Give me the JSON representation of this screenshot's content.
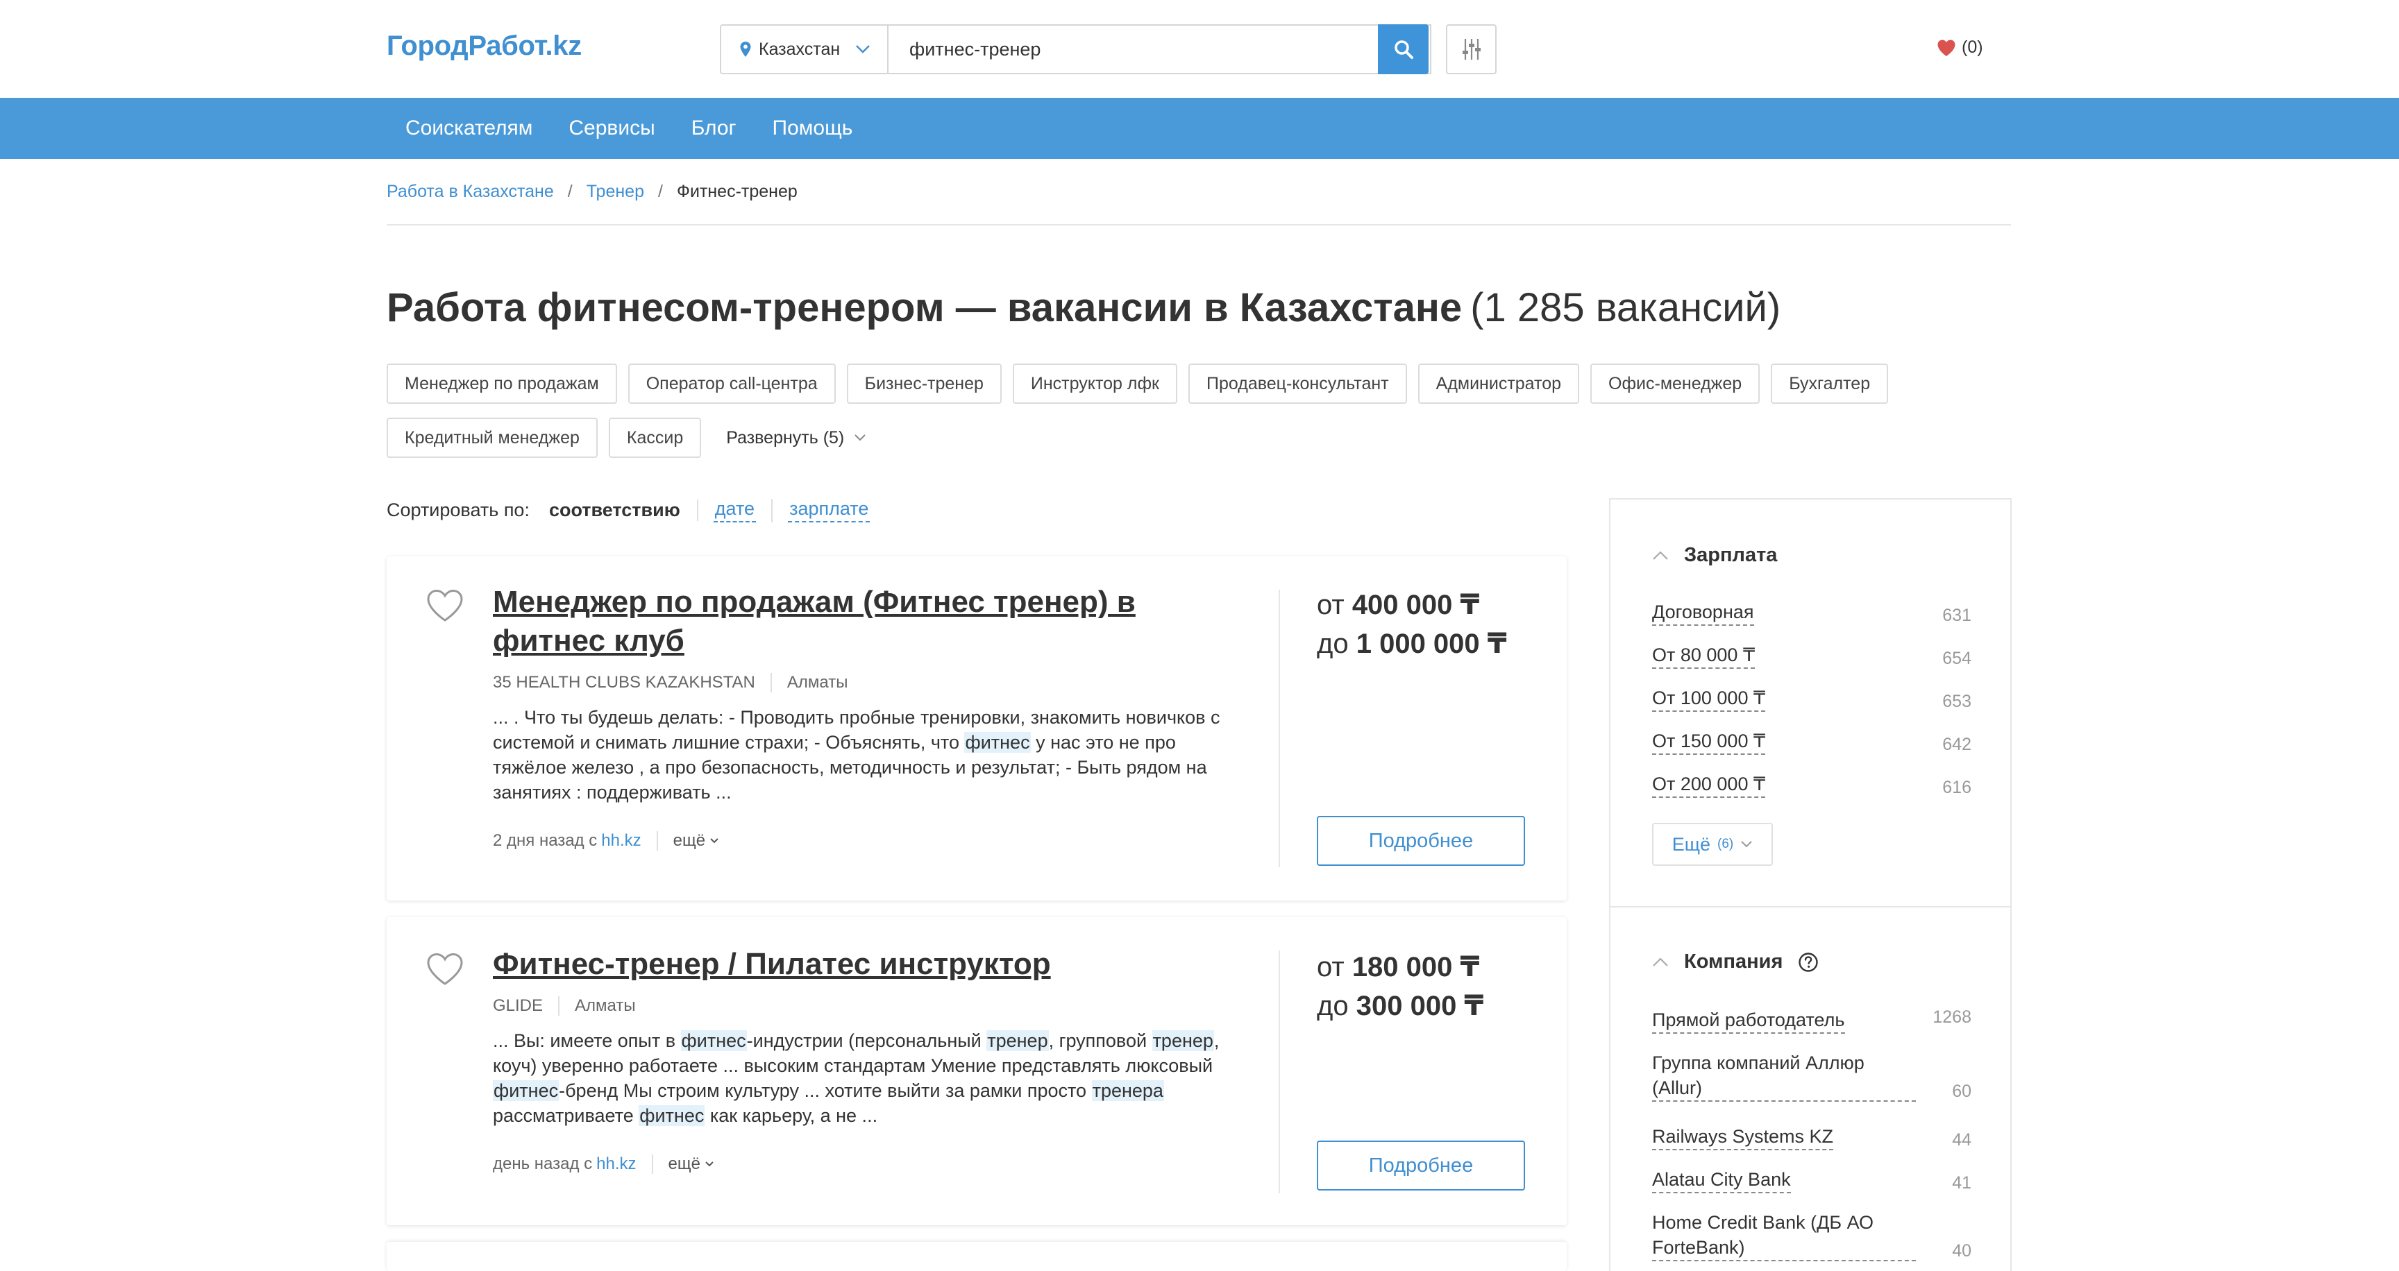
{
  "header": {
    "logo": "ГородРабот.kz",
    "region": "Казахстан",
    "query": "фитнес-тренер",
    "favorites_count": "(0)"
  },
  "nav": {
    "items": [
      "Соискателям",
      "Сервисы",
      "Блог",
      "Помощь"
    ]
  },
  "breadcrumb": {
    "items": [
      "Работа в Казахстане",
      "Тренер"
    ],
    "current": "Фитнес-тренер"
  },
  "page": {
    "title": "Работа фитнесом-тренером — вакансии в Казахстане",
    "count": "(1 285 вакансий)"
  },
  "tags": [
    "Менеджер по продажам",
    "Оператор call-центра",
    "Бизнес-тренер",
    "Инструктор лфк",
    "Продавец-консультант",
    "Администратор",
    "Офис-менеджер",
    "Бухгалтер",
    "Кредитный менеджер",
    "Кассир"
  ],
  "tags_expand": "Развернуть (5)",
  "sort": {
    "label": "Сортировать по:",
    "active": "соответствию",
    "options": [
      "дате",
      "зарплате"
    ]
  },
  "vacancies": [
    {
      "title": "Менеджер по продажам (Фитнес тренер) в фитнес клуб",
      "company": "35 HEALTH CLUBS KAZAKHSTAN",
      "city": "Алматы",
      "snippet_parts": [
        [
          "... . Что ты будешь делать: - Проводить пробные тренировки, знакомить новичков с системой и снимать лишние страхи; - Объяснять, что ",
          false
        ],
        [
          "фитнес",
          true
        ],
        [
          " у нас это не про тяжёлое железо , а про безопасность, методичность и результат; - Быть рядом на занятиях : поддерживать ...",
          false
        ]
      ],
      "posted": "2 дня назад с",
      "source": "hh.kz",
      "more": "ещё",
      "salary_from_prefix": "от",
      "salary_from": "400 000 ₸",
      "salary_to_prefix": "до",
      "salary_to": "1 000 000 ₸",
      "details": "Подробнее"
    },
    {
      "title": "Фитнес-тренер / Пилатес инструктор",
      "company": "GLIDE",
      "city": "Алматы",
      "snippet_parts": [
        [
          "... Вы: имеете опыт в ",
          false
        ],
        [
          "фитнес",
          true
        ],
        [
          "-индустрии (персональный ",
          false
        ],
        [
          "тренер",
          true
        ],
        [
          ", групповой ",
          false
        ],
        [
          "тренер",
          true
        ],
        [
          ", коуч) уверенно работаете ... высоким стандартам Умение представлять люксовый ",
          false
        ],
        [
          "фитнес",
          true
        ],
        [
          "-бренд Мы строим культуру ... хотите выйти за рамки просто ",
          false
        ],
        [
          "тренера",
          true
        ],
        [
          " рассматриваете ",
          false
        ],
        [
          "фитнес",
          true
        ],
        [
          " как карьеру, а не ...",
          false
        ]
      ],
      "posted": "день назад с",
      "source": "hh.kz",
      "more": "ещё",
      "salary_from_prefix": "от",
      "salary_from": "180 000 ₸",
      "salary_to_prefix": "до",
      "salary_to": "300 000 ₸",
      "details": "Подробнее"
    }
  ],
  "sidebar": {
    "salary": {
      "title": "Зарплата",
      "rows": [
        {
          "name": "Договорная",
          "count": "631"
        },
        {
          "name": "От 80 000 ₸",
          "count": "654"
        },
        {
          "name": "От 100 000 ₸",
          "count": "653"
        },
        {
          "name": "От 150 000 ₸",
          "count": "642"
        },
        {
          "name": "От 200 000 ₸",
          "count": "616"
        }
      ],
      "more": "Ещё",
      "more_count": "(6)"
    },
    "company": {
      "title": "Компания",
      "rows": [
        {
          "name": "Прямой работодатель",
          "count": "1268"
        },
        {
          "name": "Группа компаний Аллюр (Allur)",
          "count": "60"
        },
        {
          "name": "Railways Systems KZ",
          "count": "44"
        },
        {
          "name": "Alatau City Bank",
          "count": "41"
        },
        {
          "name": "Home Credit Bank (ДБ АО ForteBank)",
          "count": "40"
        }
      ]
    }
  },
  "colors": {
    "brand": "#3f8fd1",
    "nav_bg": "#4a9ad9",
    "highlight": "#e3f1fb",
    "favorite_heart": "#d9534f"
  }
}
